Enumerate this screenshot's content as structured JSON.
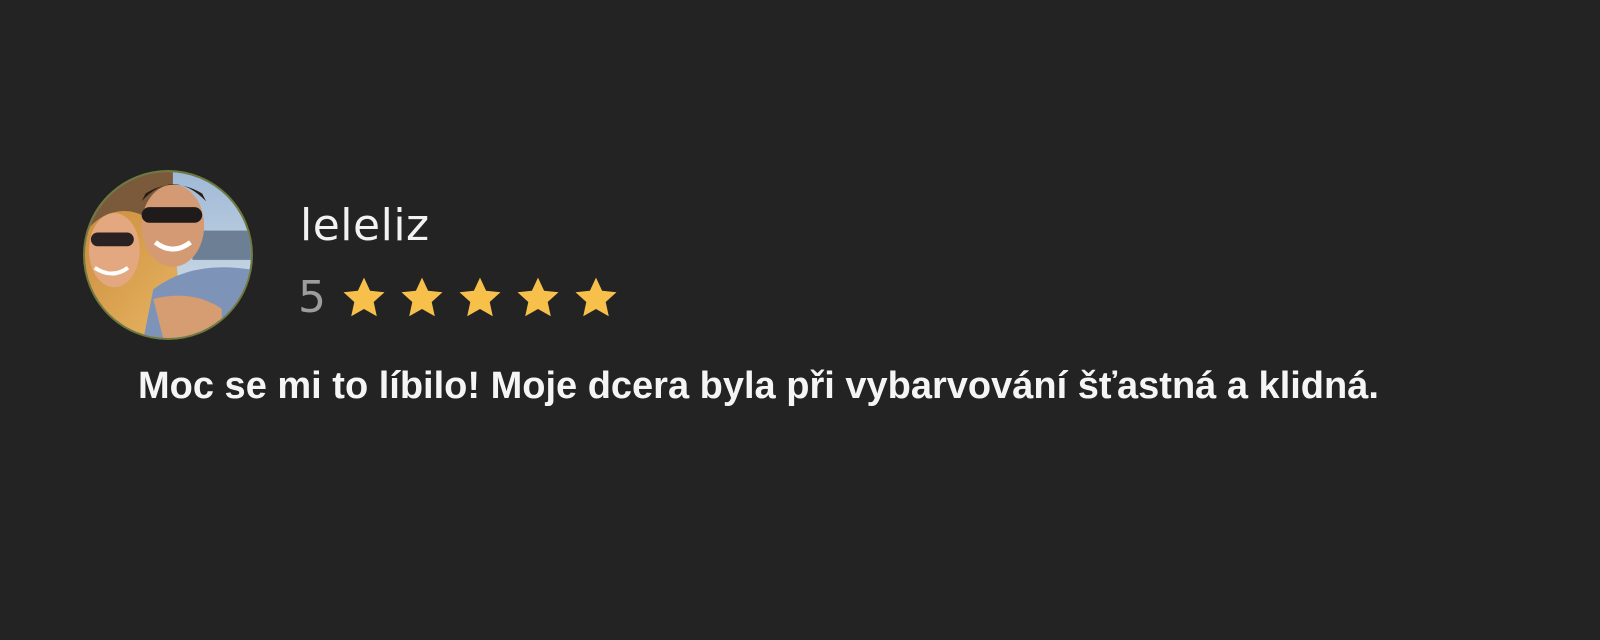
{
  "review": {
    "username": "leleliz",
    "rating_value": "5",
    "rating": 5,
    "max_rating": 5,
    "text": "Moc se mi to líbilo! Moje dcera byla při vybarvování šťastná a klidná.",
    "avatar_icon": "user-photo-avatar",
    "star_icon": "star-icon",
    "colors": {
      "background": "#232323",
      "star": "#f7c04a",
      "username": "#f2f2f2",
      "rating_number": "#9d9d9d",
      "text": "#f5f5f5"
    }
  }
}
